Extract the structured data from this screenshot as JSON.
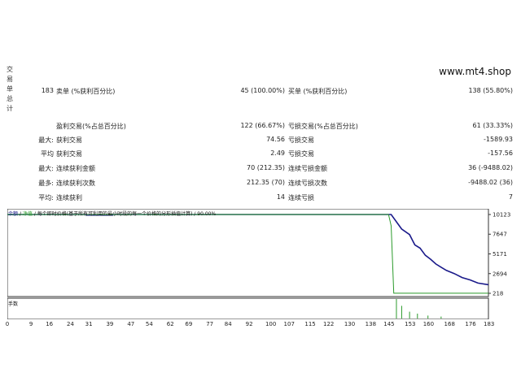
{
  "side_label": [
    "交",
    "易",
    "单",
    "总",
    "计"
  ],
  "site": "www.mt4.shop",
  "stats": {
    "total_trades": "183",
    "short_label": "卖单 (%获利百分比)",
    "short_value": "45 (100.00%)",
    "long_label": "买单 (%获利百分比)",
    "long_value": "138 (55.80%)",
    "profit_trades_label": "盈利交易(%占总百分比)",
    "profit_trades_value": "122 (66.67%)",
    "loss_trades_label": "亏损交易(%占总百分比)",
    "loss_trades_value": "61 (33.33%)",
    "max_prefix": "最大:",
    "avg_prefix": "平均",
    "max_prefix2": "最大:",
    "most_prefix": "最多:",
    "avg_prefix2": "平均:",
    "largest_profit_label": "获利交易",
    "largest_profit_value": "74.56",
    "largest_loss_label": "亏损交易",
    "largest_loss_value": "-1589.93",
    "avg_profit_label": "获利交易",
    "avg_profit_value": "2.49",
    "avg_loss_label": "亏损交易",
    "avg_loss_value": "-157.56",
    "max_consec_wins_label": "连续获利金额",
    "max_consec_wins_value": "70 (212.35)",
    "max_consec_losses_label": "连续亏损金额",
    "max_consec_losses_value": "36 (-9488.02)",
    "max_consec_profit_label": "连续获利次数",
    "max_consec_profit_value": "212.35 (70)",
    "max_consec_loss_label": "连续亏损次数",
    "max_consec_loss_value": "-9488.02 (36)",
    "avg_consec_wins_label": "连续获利",
    "avg_consec_wins_value": "14",
    "avg_consec_losses_label": "连续亏损",
    "avg_consec_losses_value": "7"
  },
  "chart_header": {
    "balance": "余额",
    "equity": "净值",
    "model_text": "每个即时价格(基于所有可利用的最小时段的每一个价格的分形插值计算)",
    "quality": "90.00%"
  },
  "volume_label": "手数",
  "chart_data": {
    "type": "line",
    "x_ticks": [
      "0",
      "9",
      "16",
      "24",
      "31",
      "39",
      "47",
      "54",
      "62",
      "69",
      "77",
      "84",
      "92",
      "100",
      "107",
      "115",
      "122",
      "130",
      "138",
      "145",
      "153",
      "160",
      "168",
      "176",
      "183"
    ],
    "y_ticks": [
      "10123",
      "7647",
      "5171",
      "2694",
      "218"
    ],
    "ylim": [
      218,
      10123
    ],
    "xlim": [
      0,
      183
    ],
    "series": [
      {
        "color": "#1a1a8a",
        "points": [
          [
            0,
            10123
          ],
          [
            30,
            10123
          ],
          [
            30,
            10050
          ],
          [
            40,
            10050
          ],
          [
            40,
            10123
          ],
          [
            146,
            10123
          ],
          [
            150,
            8300
          ],
          [
            153,
            7600
          ],
          [
            155,
            6300
          ],
          [
            157,
            5900
          ],
          [
            159,
            5000
          ],
          [
            161,
            4500
          ],
          [
            163,
            3900
          ],
          [
            165,
            3500
          ],
          [
            167,
            3100
          ],
          [
            170,
            2700
          ],
          [
            173,
            2200
          ],
          [
            176,
            1900
          ],
          [
            179,
            1500
          ],
          [
            183,
            1300
          ]
        ]
      },
      {
        "color": "#2a9a2a",
        "points": [
          [
            0,
            10123
          ],
          [
            145,
            10123
          ],
          [
            146,
            8700
          ],
          [
            147,
            230
          ],
          [
            183,
            230
          ]
        ]
      }
    ],
    "volume_bars": [
      [
        148,
        1.0
      ],
      [
        150,
        0.65
      ],
      [
        153,
        0.35
      ],
      [
        156,
        0.25
      ],
      [
        160,
        0.15
      ],
      [
        165,
        0.1
      ]
    ]
  }
}
